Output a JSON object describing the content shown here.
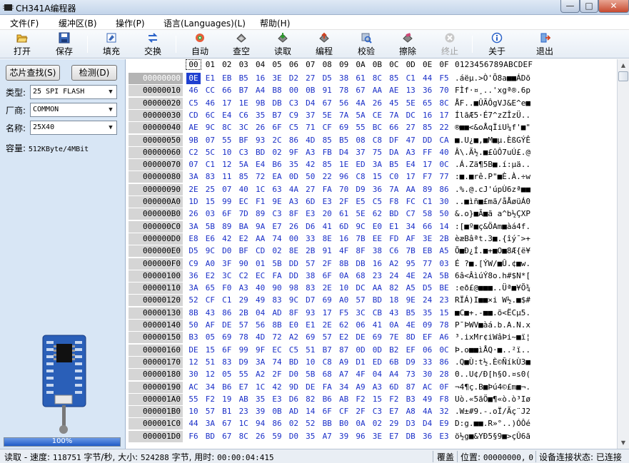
{
  "window": {
    "title": "CH341A编程器"
  },
  "menu": [
    "文件(F)",
    "缓冲区(B)",
    "操作(P)",
    "语言(Languages)(L)",
    "帮助(H)"
  ],
  "toolbar": [
    {
      "label": "打开",
      "icon": "open-folder-icon"
    },
    {
      "label": "保存",
      "icon": "save-disk-icon"
    },
    {
      "label": "填充",
      "icon": "fill-icon"
    },
    {
      "label": "交换",
      "icon": "swap-arrows-icon"
    },
    {
      "label": "自动",
      "icon": "auto-icon"
    },
    {
      "label": "查空",
      "icon": "blank-check-icon"
    },
    {
      "label": "读取",
      "icon": "read-icon"
    },
    {
      "label": "编程",
      "icon": "program-icon"
    },
    {
      "label": "校验",
      "icon": "verify-icon"
    },
    {
      "label": "擦除",
      "icon": "erase-icon"
    },
    {
      "label": "终止",
      "icon": "stop-icon"
    },
    {
      "label": "关于",
      "icon": "info-icon"
    },
    {
      "label": "退出",
      "icon": "exit-icon"
    }
  ],
  "left": {
    "find_chip": "芯片查找(S)",
    "detect": "检测(D)",
    "type_label": "类型:",
    "type_value": "25 SPI FLASH",
    "vendor_label": "厂商:",
    "vendor_value": "COMMON",
    "name_label": "名称:",
    "name_value": "25X40",
    "capacity_label": "容量:",
    "capacity_value": "512KByte/4MBit",
    "progress": {
      "percent": 100,
      "text": "100%"
    }
  },
  "hex": {
    "header_cols": [
      "00",
      "01",
      "02",
      "03",
      "04",
      "05",
      "06",
      "07",
      "08",
      "09",
      "0A",
      "0B",
      "0C",
      "0D",
      "0E",
      "0F"
    ],
    "ascii_header": "0123456789ABCDEF",
    "rows": [
      {
        "addr": "00000000",
        "bytes": "0E E1 EB B5 16 3E D2 27 D5 38 61 8C 85 C1 44 F5",
        "ascii": ".áëµ.>Ò'Õ8a■■ÁDõ"
      },
      {
        "addr": "00000010",
        "bytes": "46 CC 66 B7 A4 B8 00 0B 91 78 67 AA AE 13 36 70",
        "ascii": "FÌf·¤¸..'xgª®.6p"
      },
      {
        "addr": "00000020",
        "bytes": "C5 46 17 1E 9B DB C3 D4 67 56 4A 26 45 5E 65 8C",
        "ascii": "ÅF..■ÛÃÔgVJ&E^e■"
      },
      {
        "addr": "00000030",
        "bytes": "CD 6C E4 C6 35 B7 C9 37 5E 7A 5A CE 7A DC 16 17",
        "ascii": "ÍlãÆ5·É7^zZÎzÜ.."
      },
      {
        "addr": "00000040",
        "bytes": "AE 9C 8C 3C 26 6F C5 71 CF 69 55 BC 66 27 85 22",
        "ascii": "®■■<&oÅqÏiU¼f'■\""
      },
      {
        "addr": "00000050",
        "bytes": "9B 07 55 BF 93 2C 86 4D 85 B5 08 C8 DF 47 DD CA",
        "ascii": "■.U¿■,■M■µ.ÈßGÝÊ"
      },
      {
        "addr": "00000060",
        "bytes": "C2 5C 10 C3 BD 02 9F A3 FB D4 37 75 DA A3 FF 40",
        "ascii": "Â\\.Ã½.■£ûÔ7uÚ£.@"
      },
      {
        "addr": "00000070",
        "bytes": "07 C1 12 5A E4 B6 35 42 85 1E ED 3A B5 E4 17 0C",
        "ascii": ".Á.Zä¶5B■.í:µä.."
      },
      {
        "addr": "00000080",
        "bytes": "3A 83 11 85 72 EA 0D 50 22 96 C8 15 C0 17 F7 77",
        "ascii": ":■.■rê.P\"■È.À.÷w"
      },
      {
        "addr": "00000090",
        "bytes": "2E 25 07 40 1C 63 4A 27 FA 70 D9 36 7A AA 89 86",
        "ascii": ".%.@.cJ'úpÙ6zª■■"
      },
      {
        "addr": "000000A0",
        "bytes": "1D 15 99 EC F1 9E A3 6D E3 2F E5 C5 F8 FC C1 30",
        "ascii": "..■ìñ■£mã/åÅøüÁ0"
      },
      {
        "addr": "000000B0",
        "bytes": "26 03 6F 7D 89 C3 8F E3 20 61 5E 62 BD C7 58 50",
        "ascii": "&.o}■Ã■ã a^b½ÇXP"
      },
      {
        "addr": "000000C0",
        "bytes": "3A 5B 89 BA 9A E7 26 D6 41 6D 9C E0 E1 34 66 14",
        "ascii": ":[■º■ç&ÖAm■àá4f."
      },
      {
        "addr": "000000D0",
        "bytes": "E8 E6 42 E2 AA 74 00 33 8E 16 7B EE FD AF 3E 2B",
        "ascii": "èæBâªt.3■.{îý¯>+"
      },
      {
        "addr": "000000E0",
        "bytes": "D5 9C D0 BF CD 02 8E 2B 91 4F 8F 38 C6 7B EB A5",
        "ascii": "Õ■Ð¿Í.■+■O■8Æ{ë¥"
      },
      {
        "addr": "000000F0",
        "bytes": "C9 A0 3F 90 01 5B DD 57 2F 8B DB 16 A2 95 77 03",
        "ascii": "É ?■.[ÝW/■Û.¢■w."
      },
      {
        "addr": "00000100",
        "bytes": "36 E2 3C C2 EC FA DD 38 6F 0A 68 23 24 4E 2A 5B",
        "ascii": "6â<ÂìúÝ8o.h#$N*["
      },
      {
        "addr": "00000110",
        "bytes": "3A 65 F0 A3 40 90 98 83 2E 10 DC AA 82 A5 D5 BE",
        "ascii": ":eð£@■■■..Üª■¥Õ¾"
      },
      {
        "addr": "00000120",
        "bytes": "52 CF C1 29 49 83 9C D7 69 A0 57 BD 18 9E 24 23",
        "ascii": "RÏÁ)I■■×i W½.■$#"
      },
      {
        "addr": "00000130",
        "bytes": "8B 43 86 2B 04 AD 8F 93 17 F5 3C CB 43 B5 35 15",
        "ascii": "■C■+.-■■.õ<ËCµ5."
      },
      {
        "addr": "00000140",
        "bytes": "50 AF DE 57 56 8B E0 E1 2E 62 06 41 0A 4E 09 78",
        "ascii": "P¯ÞWV■àá.b.A.N.x"
      },
      {
        "addr": "00000150",
        "bytes": "B3 05 69 78 4D 72 A2 69 57 E2 DE 69 7E 8D EF A6",
        "ascii": "³.ixMr¢iWâÞi~■ï¦"
      },
      {
        "addr": "00000160",
        "bytes": "DE 15 6F 99 9F EC C5 51 B7 87 0D 0D B2 EF 06 0C",
        "ascii": "Þ.o■■ìÅQ·■..²ï.."
      },
      {
        "addr": "00000170",
        "bytes": "12 51 83 D9 3A 74 BD 10 C8 A9 D1 ED 6B D9 33 86",
        "ascii": ".Q■Ù:t½.È©ÑíkÙ3■"
      },
      {
        "addr": "00000180",
        "bytes": "30 12 05 55 A2 2F D0 5B 68 A7 4F 04 A4 73 30 28",
        "ascii": "0..U¢/Ð[h§O.¤s0("
      },
      {
        "addr": "00000190",
        "bytes": "AC 34 B6 E7 1C 42 9D DE FA 34 A9 A3 6D 87 AC 0F",
        "ascii": "¬4¶ç.B■Þú4©£m■¬."
      },
      {
        "addr": "000001A0",
        "bytes": "55 F2 19 AB 35 E3 D6 82 B6 AB F2 15 F2 B3 49 F8",
        "ascii": "Uò.«5ãÖ■¶«ò.ò³Iø"
      },
      {
        "addr": "000001B0",
        "bytes": "10 57 B1 23 39 0B AD 14 6F CF 2F C3 E7 A8 4A 32",
        "ascii": ".W±#9.-.oÏ/Ãç¨J2"
      },
      {
        "addr": "000001C0",
        "bytes": "44 3A 67 1C 94 86 02 52 BB B0 0A 02 29 D3 D4 E9",
        "ascii": "D:g.■■.R»°..)ÓÔé"
      },
      {
        "addr": "000001D0",
        "bytes": "F6 BD 67 8C 26 59 D0 35 A7 39 96 3E E7 DB 36 E3",
        "ascii": "ö½g■&YÐ5§9■>çÛ6ã"
      }
    ]
  },
  "status": {
    "read_label": "读取 - 速度:",
    "speed_value": "118751",
    "speed_unit": "字节/秒,",
    "size_label": "大小:",
    "size_value": "524288",
    "size_unit": "字节,",
    "time_label": "用时:",
    "time_value": "00:00:04:415",
    "overwrite": "覆盖",
    "position_label": "位置:",
    "position_value": "00000000,",
    "position_col": "0",
    "device_status": "设备连接状态: 已连接"
  }
}
